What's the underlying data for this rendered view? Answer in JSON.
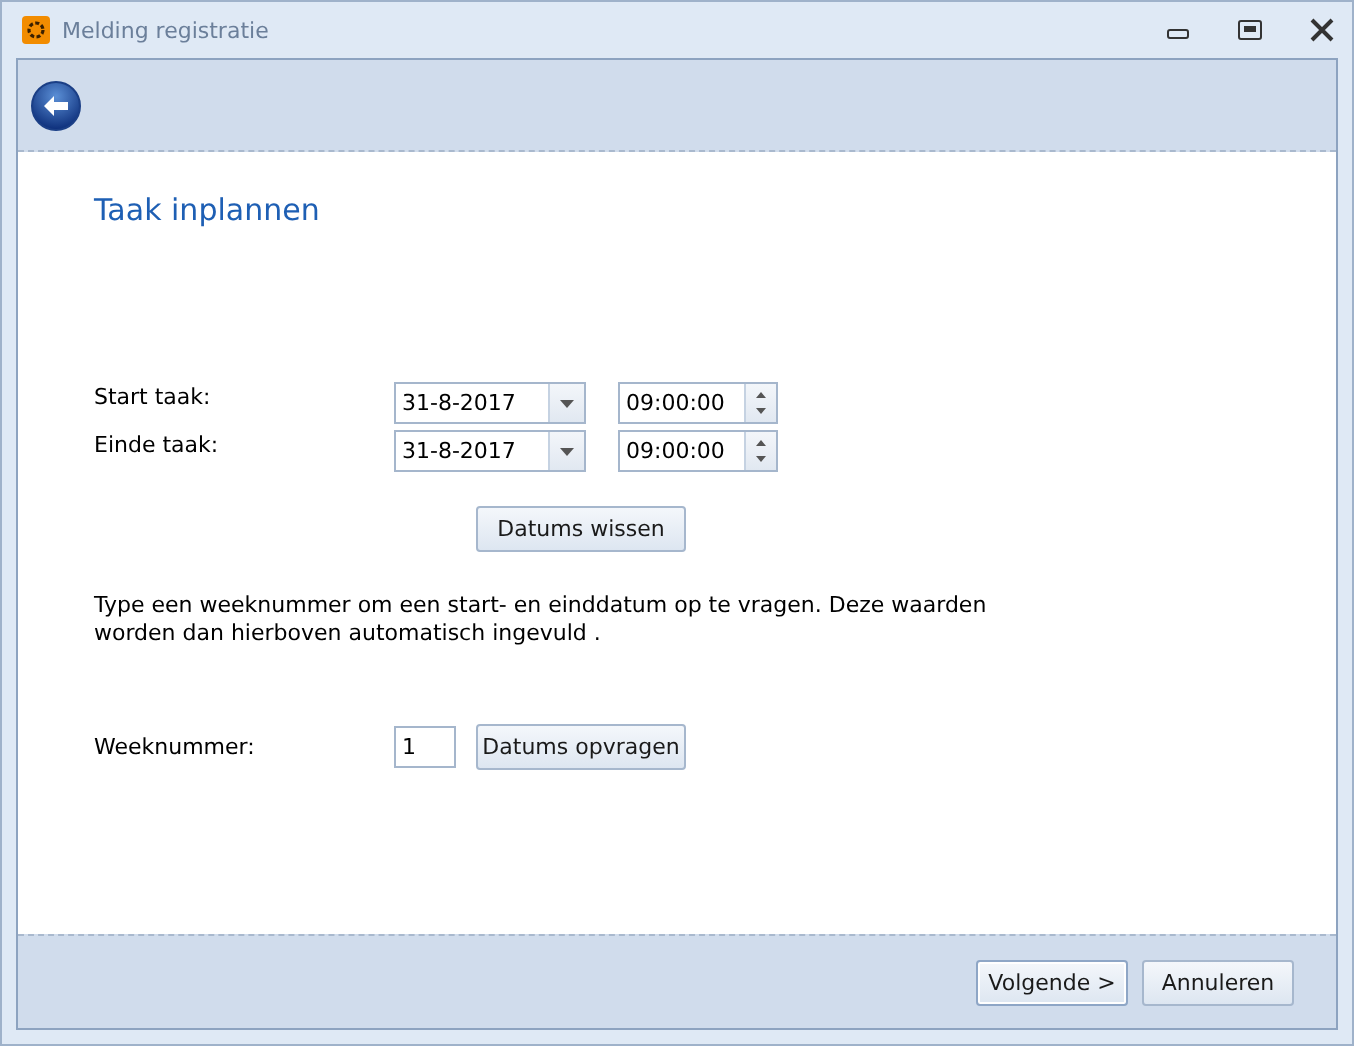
{
  "window": {
    "title": "Melding registratie"
  },
  "heading": "Taak inplannen",
  "task_rows": [
    {
      "label": "Start taak:",
      "date": "31-8-2017",
      "time": "09:00:00"
    },
    {
      "label": "Einde taak:",
      "date": "31-8-2017",
      "time": "09:00:00"
    }
  ],
  "clear_button": "Datums wissen",
  "instructions": "Type een weeknummer om een start- en einddatum op te vragen. Deze waarden worden dan hierboven automatisch ingevuld .",
  "week": {
    "label": "Weeknummer:",
    "value": "1",
    "button": "Datums opvragen"
  },
  "footer_buttons": [
    {
      "label": "Volgende >",
      "selected": true
    },
    {
      "label": "Annuleren",
      "selected": false
    }
  ]
}
